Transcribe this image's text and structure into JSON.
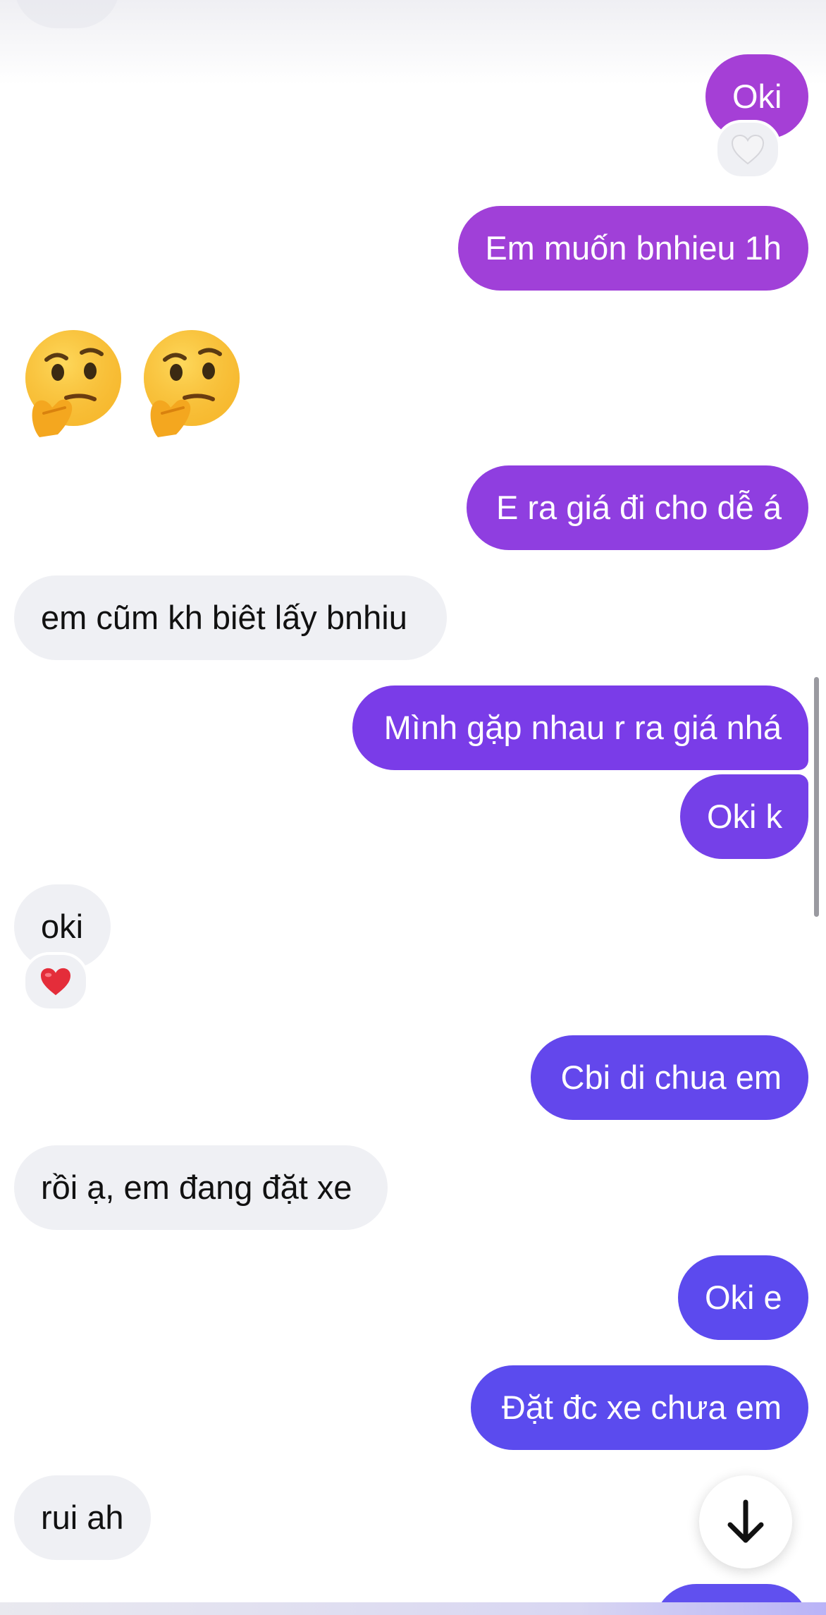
{
  "conversation": {
    "messages": [
      {
        "id": "m1",
        "side": "outgoing",
        "text": "Oki",
        "color": "#a53fd6",
        "reaction": "white-heart-icon"
      },
      {
        "id": "m2",
        "side": "outgoing",
        "text": "Em muốn bnhieu 1h",
        "color": "#a040d8"
      },
      {
        "id": "m3",
        "side": "incoming",
        "emojis": [
          "thinking-face-icon",
          "thinking-face-icon"
        ]
      },
      {
        "id": "m4",
        "side": "outgoing",
        "text": "E ra giá đi cho dễ á",
        "color": "#8f3ee0"
      },
      {
        "id": "m5",
        "side": "incoming",
        "text": "em cũm kh biêt lấy bnhiu"
      },
      {
        "id": "m6",
        "side": "outgoing",
        "text": "Mình gặp nhau r ra giá nhá",
        "color": "#7a3ce8"
      },
      {
        "id": "m7",
        "side": "outgoing",
        "text": "Oki k",
        "color": "#7540e8"
      },
      {
        "id": "m8",
        "side": "incoming",
        "text": "oki",
        "reaction": "red-heart-icon"
      },
      {
        "id": "m9",
        "side": "outgoing",
        "text": "Cbi di chua em",
        "color": "#6347ec"
      },
      {
        "id": "m10",
        "side": "incoming",
        "text": "rồi ạ, em đang đặt xe"
      },
      {
        "id": "m11",
        "side": "outgoing",
        "text": "Oki e",
        "color": "#5c4aee"
      },
      {
        "id": "m12",
        "side": "outgoing",
        "text": "Đặt đc xe chưa em",
        "color": "#5b4bee"
      },
      {
        "id": "m13",
        "side": "incoming",
        "text": "rui ah"
      }
    ]
  },
  "controls": {
    "scroll_to_bottom_icon": "arrow-down-icon"
  },
  "colors": {
    "incoming_bubble": "#eff0f4",
    "incoming_text": "#111111",
    "outgoing_text": "#ffffff"
  }
}
